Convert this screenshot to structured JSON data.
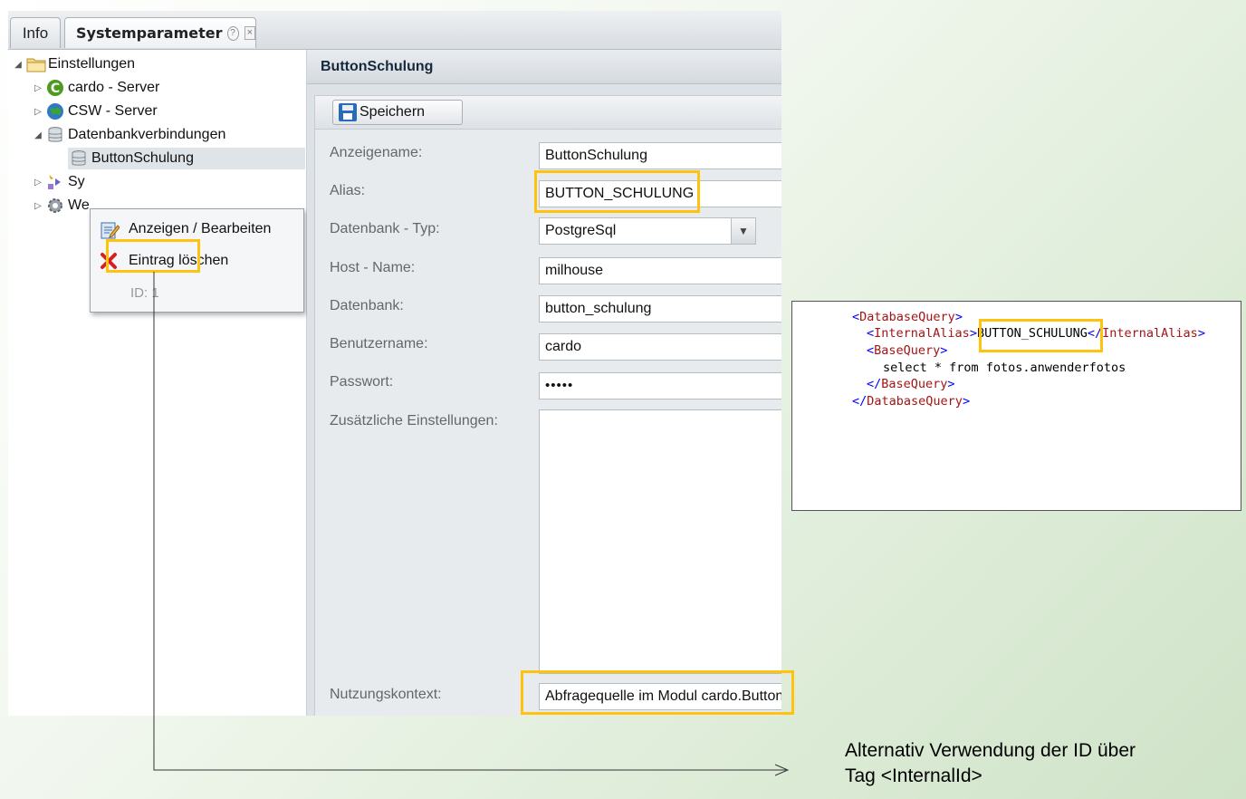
{
  "tabs": [
    {
      "label": "Info"
    },
    {
      "label": "Systemparameter",
      "help_icon": "?",
      "close_icon": "×"
    }
  ],
  "tree": {
    "root": "Einstellungen",
    "items": [
      {
        "label": "cardo - Server"
      },
      {
        "label": "CSW - Server"
      },
      {
        "label": "Datenbankverbindungen"
      },
      {
        "label": "ButtonSchulung"
      },
      {
        "label": "Sy"
      },
      {
        "label": "We"
      }
    ]
  },
  "context_menu": {
    "items": [
      {
        "label": "Anzeigen / Bearbeiten"
      },
      {
        "label": "Eintrag löschen"
      }
    ],
    "id_label": "ID: 1"
  },
  "panel": {
    "title": "ButtonSchulung",
    "save_label": "Speichern",
    "fields": {
      "anzeigename": {
        "label": "Anzeigename:",
        "value": "ButtonSchulung"
      },
      "alias": {
        "label": "Alias:",
        "value": "BUTTON_SCHULUNG"
      },
      "datenbank_typ": {
        "label": "Datenbank - Typ:",
        "value": "PostgreSql"
      },
      "host": {
        "label": "Host - Name:",
        "value": "milhouse"
      },
      "datenbank": {
        "label": "Datenbank:",
        "value": "button_schulung"
      },
      "benutzername": {
        "label": "Benutzername:",
        "value": "cardo"
      },
      "passwort": {
        "label": "Passwort:",
        "value": "•••••"
      },
      "zusatz": {
        "label": "Zusätzliche Einstellungen:",
        "value": ""
      },
      "nutzung": {
        "label": "Nutzungskontext:",
        "value": "Abfragequelle im Modul cardo.Button"
      }
    }
  },
  "code": {
    "open_dq": "DatabaseQuery",
    "ia_tag": "InternalAlias",
    "ia_value": "BUTTON_SCHULUNG",
    "bq_tag": "BaseQuery",
    "query": "select * from fotos.anwenderfotos"
  },
  "note": {
    "line1": "Alternativ Verwendung der ID über",
    "line2": "Tag <InternalId>"
  },
  "colors": {
    "highlight": "#ffc20e",
    "xml_bracket": "#0000ff",
    "xml_tag": "#a31515"
  }
}
